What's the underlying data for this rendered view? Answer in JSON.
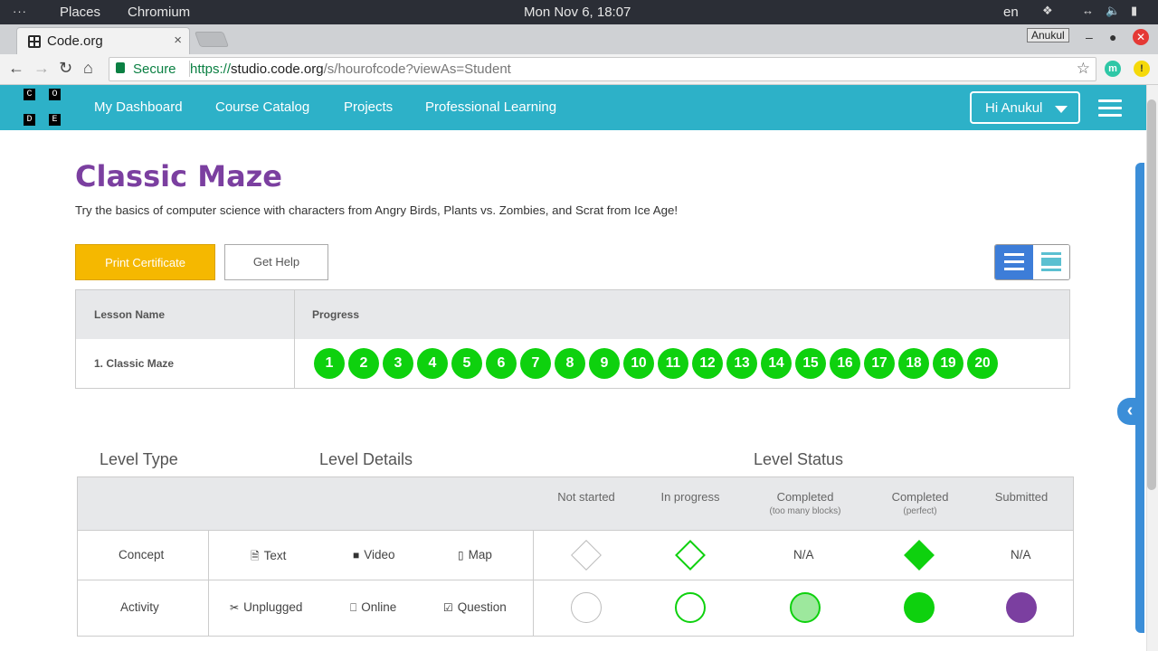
{
  "os": {
    "activities": "···",
    "places": "Places",
    "app": "Chromium",
    "clock": "Mon Nov  6, 18:07",
    "lang": "en"
  },
  "browser": {
    "tab_title": "Code.org",
    "tab_close": "×",
    "profile": "Anukul",
    "secure_label": "Secure",
    "url_scheme": "https://",
    "url_host": "studio.code.org",
    "url_path": "/s/hourofcode?viewAs=Student"
  },
  "site": {
    "logo_letters": [
      "C",
      "O",
      "D",
      "E"
    ],
    "nav": [
      "My Dashboard",
      "Course Catalog",
      "Projects",
      "Professional Learning"
    ],
    "user_button": "Hi Anukul"
  },
  "course": {
    "title": "Classic Maze",
    "description": "Try the basics of computer science with characters from Angry Birds, Plants vs. Zombies, and Scrat from Ice Age!",
    "print_button": "Print Certificate",
    "help_button": "Get Help"
  },
  "progress_table": {
    "col_lesson": "Lesson Name",
    "col_progress": "Progress",
    "lesson_name": "1. Classic Maze",
    "levels": [
      "1",
      "2",
      "3",
      "4",
      "5",
      "6",
      "7",
      "8",
      "9",
      "10",
      "11",
      "12",
      "13",
      "14",
      "15",
      "16",
      "17",
      "18",
      "19",
      "20"
    ]
  },
  "legend": {
    "level_type": "Level Type",
    "level_details": "Level Details",
    "level_status": "Level Status",
    "statuses": {
      "not_started": "Not started",
      "in_progress": "In progress",
      "completed": "Completed",
      "completed_note": "(too many blocks)",
      "completed_perfect": "Completed",
      "perfect_note": "(perfect)",
      "submitted": "Submitted"
    },
    "concept": {
      "label": "Concept",
      "text": "Text",
      "video": "Video",
      "map": "Map",
      "na1": "N/A",
      "na2": "N/A"
    },
    "activity": {
      "label": "Activity",
      "unplugged": "Unplugged",
      "online": "Online",
      "question": "Question"
    }
  },
  "colors": {
    "brand_teal": "#2db1c8",
    "title_purple": "#7b3fa0",
    "print_yellow": "#f5b800",
    "progress_green": "#0ed10e",
    "submitted_purple": "#7b3fa0"
  }
}
